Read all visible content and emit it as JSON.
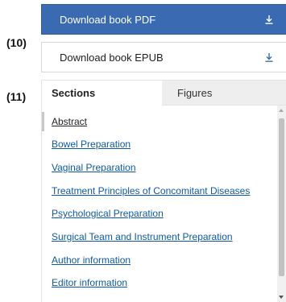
{
  "annotations": {
    "a10": "(10)",
    "a11": "(11)"
  },
  "downloads": {
    "pdf_label": "Download book PDF",
    "epub_label": "Download book EPUB",
    "icon": "download-icon"
  },
  "tabs": {
    "sections": "Sections",
    "figures": "Figures"
  },
  "sections": [
    "Abstract",
    "Bowel Preparation",
    "Vaginal Preparation",
    "Treatment Principles of Concomitant Diseases",
    "Psychological Preparation",
    "Surgical Team and Instrument Preparation",
    "Author information",
    "Editor information"
  ],
  "colors": {
    "accent": "#3a6ab2",
    "link": "#0d5aa7"
  }
}
